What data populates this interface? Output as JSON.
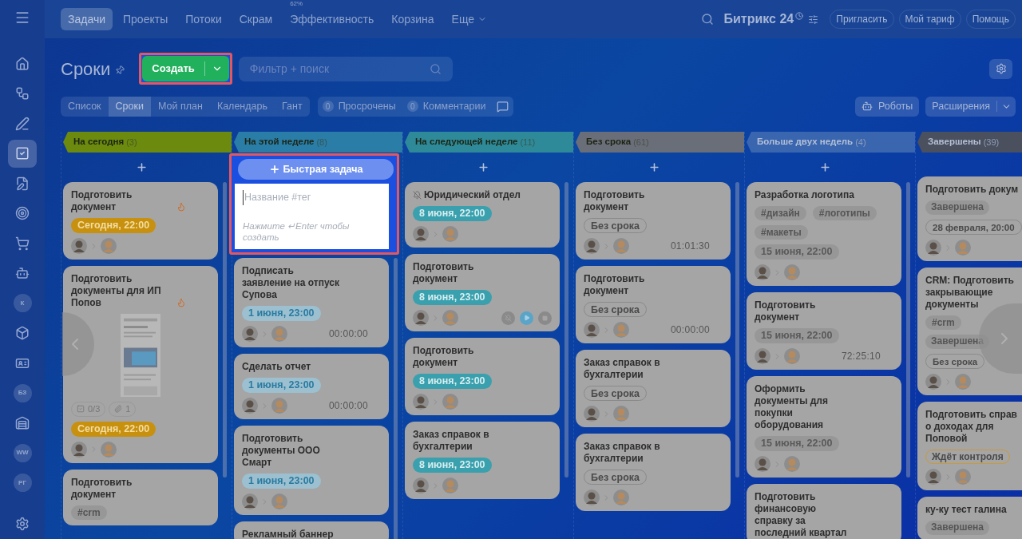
{
  "sidebar": {
    "items": [
      {
        "kind": "icon",
        "selected": false
      },
      {
        "kind": "icon",
        "selected": false
      },
      {
        "kind": "icon",
        "selected": false
      },
      {
        "kind": "icon",
        "selected": true
      },
      {
        "kind": "icon",
        "selected": false
      },
      {
        "kind": "icon",
        "selected": false
      },
      {
        "kind": "icon",
        "selected": false
      },
      {
        "kind": "icon",
        "selected": false
      },
      {
        "kind": "initials",
        "text": "К",
        "selected": false
      },
      {
        "kind": "icon",
        "selected": false
      },
      {
        "kind": "icon",
        "selected": false
      },
      {
        "kind": "initials",
        "text": "БЗ",
        "selected": false
      },
      {
        "kind": "icon",
        "selected": false
      },
      {
        "kind": "initials",
        "text": "WW",
        "selected": false
      },
      {
        "kind": "initials",
        "text": "РГ",
        "selected": false
      }
    ]
  },
  "top_nav": {
    "tabs": [
      {
        "label": "Задачи",
        "selected": true
      },
      {
        "label": "Проекты",
        "selected": false
      },
      {
        "label": "Потоки",
        "selected": false
      },
      {
        "label": "Скрам",
        "selected": false
      },
      {
        "label": "Эффективность",
        "badge": "62%",
        "selected": false
      },
      {
        "label": "Корзина",
        "selected": false
      },
      {
        "label": "Еще",
        "has_menu": true,
        "selected": false
      }
    ],
    "logo": "Битрикс 24",
    "buttons": [
      "Пригласить",
      "Мой тариф",
      "Помощь"
    ]
  },
  "toolbar": {
    "title": "Сроки",
    "create_button": "Создать",
    "filter": {
      "placeholder": "Фильтр + поиск"
    }
  },
  "views": [
    {
      "label": "Список",
      "selected": false
    },
    {
      "label": "Сроки",
      "selected": true
    },
    {
      "label": "Мой план",
      "selected": false
    },
    {
      "label": "Календарь",
      "selected": false
    },
    {
      "label": "Гант",
      "selected": false
    }
  ],
  "counters": [
    {
      "count": "0",
      "label": "Просрочены"
    },
    {
      "count": "0",
      "label": "Комментарии"
    }
  ],
  "robots_button": "Роботы",
  "extensions_button": "Расширения",
  "columns": [
    {
      "title": "На сегодня",
      "count": "(3)",
      "color": "#6b8a0e",
      "dark_text": true,
      "can_add": true,
      "cards": [
        {
          "title": "Подготовить документ",
          "flame": true,
          "deadline": {
            "text": "Сегодня, 22:00",
            "kind": "today"
          },
          "assigned": true
        },
        {
          "title": "Подготовить документы для ИП Попов",
          "flame": true,
          "preview": true,
          "checklist": "0/3",
          "files": "1",
          "deadline": {
            "text": "Сегодня, 22:00",
            "kind": "today"
          },
          "assigned": true
        },
        {
          "title": "Подготовить документ",
          "tags": [
            "#crm"
          ]
        }
      ]
    },
    {
      "title": "На этой неделе",
      "count": "(8)",
      "color": "#2a7da6",
      "dark_text": true,
      "can_add": false,
      "quick_task": {
        "button": "Быстрая задача",
        "placeholder": "Название #тег",
        "hint": "Нажмите ↵Enter чтобы создать"
      },
      "cards": [
        {
          "title": "Подписать заявление на отпуск Супова",
          "deadline": {
            "text": "1 июня, 23:00",
            "kind": "week"
          },
          "assigned": true,
          "timer": "00:00:00"
        },
        {
          "title": "Сделать отчет",
          "deadline": {
            "text": "1 июня, 23:00",
            "kind": "week"
          },
          "assigned": true,
          "timer": "00:00:00"
        },
        {
          "title": "Подготовить документы ООО Смарт",
          "deadline": {
            "text": "1 июня, 23:00",
            "kind": "week"
          },
          "assigned": true
        },
        {
          "title": "Рекламный баннер"
        }
      ]
    },
    {
      "title": "На следующей неделе",
      "count": "(11)",
      "color": "#2e8a98",
      "dark_text": true,
      "can_add": true,
      "cards": [
        {
          "title": "Юридический отдел",
          "muted": true,
          "deadline": {
            "text": "8 июня, 22:00",
            "kind": "next"
          },
          "assigned": true
        },
        {
          "title": "Подготовить документ",
          "deadline": {
            "text": "8 июня, 23:00",
            "kind": "next"
          },
          "assigned": true,
          "controls": true
        },
        {
          "title": "Подготовить документ",
          "deadline": {
            "text": "8 июня, 23:00",
            "kind": "next"
          },
          "assigned": true
        },
        {
          "title": "Заказ справок в бухгалтерии",
          "deadline": {
            "text": "8 июня, 23:00",
            "kind": "next"
          },
          "assigned": true
        }
      ]
    },
    {
      "title": "Без срока",
      "count": "(61)",
      "color": "#6a6e78",
      "dark_text": true,
      "can_add": true,
      "cards": [
        {
          "title": "Подготовить документ",
          "deadline": {
            "text": "Без срока",
            "kind": "none"
          },
          "assigned": true,
          "timer": "01:01:30"
        },
        {
          "title": "Подготовить документ",
          "deadline": {
            "text": "Без срока",
            "kind": "none"
          },
          "assigned": true,
          "timer": "00:00:00"
        },
        {
          "title": "Заказ справок в бухгалтерии",
          "deadline": {
            "text": "Без срока",
            "kind": "none"
          },
          "assigned": true
        },
        {
          "title": "Заказ справок в бухгалтерии",
          "deadline": {
            "text": "Без срока",
            "kind": "none"
          },
          "assigned": true
        }
      ]
    },
    {
      "title": "Больше двух недель",
      "count": "(4)",
      "color": "#3a66b0",
      "dark_text": false,
      "can_add": true,
      "cards": [
        {
          "title": "Разработка логотипа",
          "tags": [
            "#дизайн",
            "#логотипы",
            "#макеты"
          ],
          "deadline": {
            "text": "15 июня, 22:00",
            "kind": "later"
          },
          "assigned": true
        },
        {
          "title": "Подготовить документ",
          "deadline": {
            "text": "15 июня, 22:00",
            "kind": "later"
          },
          "assigned": true,
          "timer": "72:25:10"
        },
        {
          "title": "Оформить документы для покупки оборудования",
          "deadline": {
            "text": "15 июня, 22:00",
            "kind": "later"
          },
          "assigned": true
        },
        {
          "title": "Подготовить финансовую справку за последний квартал"
        }
      ]
    },
    {
      "title": "Завершены",
      "count": "(39)",
      "color": "#4a505e",
      "dark_text": false,
      "can_add": false,
      "cards": [
        {
          "title": "Подготовить докум",
          "statuses": [
            {
              "text": "Завершена",
              "kind": "done"
            }
          ],
          "deadline": {
            "text": "28 февраля, 20:00",
            "kind": "none"
          },
          "assigned": true
        },
        {
          "title": "CRM: Подготовить\nзакрывающие\nдокументы",
          "tags": [
            "#crm"
          ],
          "statuses": [
            {
              "text": "Завершена",
              "kind": "done"
            }
          ],
          "deadline": {
            "text": "Без срока",
            "kind": "none"
          },
          "assigned": true
        },
        {
          "title": "Подготовить справ\nо доходах для\nПоповой",
          "statuses": [
            {
              "text": "Ждёт контроля",
              "kind": "waiting"
            }
          ],
          "assigned": true
        },
        {
          "title": "ку-ку тест галина",
          "statuses": [
            {
              "text": "Завершена",
              "kind": "done"
            }
          ]
        }
      ]
    }
  ]
}
